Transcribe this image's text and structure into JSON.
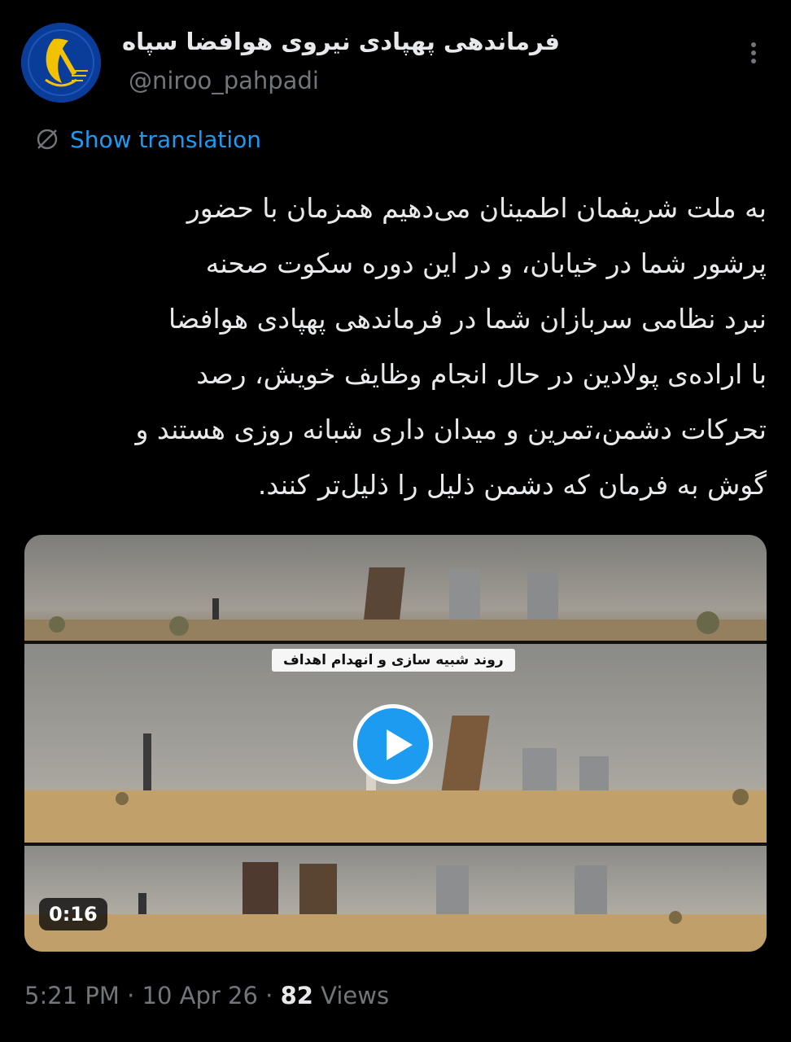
{
  "author": {
    "display_name": "فرماندهی پهپادی نیروی هوافضا سپاه",
    "handle": "@niroo_pahpadi"
  },
  "actions": {
    "more_icon": "more-vertical-icon",
    "translate_icon": "globe-slash-icon",
    "translate_label": "Show translation"
  },
  "tweet": {
    "lines": [
      "به ملت شریفمان اطمینان می‌دهیم همزمان با حضور",
      "پرشور شما در خیابان، و در این دوره سکوت صحنه",
      "نبرد نظامی سربازان شما در فرماندهی پهپادی هوافضا",
      "با اراده‌ی پولادین در حال انجام وظایف خویش، رصد",
      "تحرکات دشمن،تمرین و میدان داری شبانه روزی هستند و",
      "گوش به فرمان که دشمن ذلیل را ذلیل‌تر کنند."
    ]
  },
  "video": {
    "caption": "روند شبیه سازی و انهدام اهداف",
    "duration": "0:16",
    "play_icon": "play-icon"
  },
  "meta": {
    "time": "5:21 PM",
    "sep1": " · ",
    "date": "10 Apr 26",
    "sep2": " · ",
    "views_count": "82",
    "views_label": " Views"
  },
  "colors": {
    "background": "#000000",
    "text": "#e7e9ea",
    "secondary": "#71767b",
    "accent": "#1d9bf0"
  }
}
